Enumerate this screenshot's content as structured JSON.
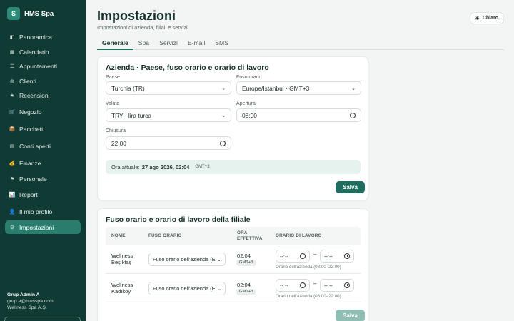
{
  "app": {
    "logo_letter": "S",
    "name": "HMS Spa"
  },
  "sidebar": {
    "items": [
      {
        "label": "Panoramica",
        "icon": "dashboard-icon",
        "glyph": "◧"
      },
      {
        "label": "Calendario",
        "icon": "calendar-icon",
        "glyph": "▦"
      },
      {
        "label": "Appuntamenti",
        "icon": "appointments-icon",
        "glyph": "☰"
      },
      {
        "label": "Clienti",
        "icon": "clients-icon",
        "glyph": "◍"
      },
      {
        "label": "Recensioni",
        "icon": "star-icon",
        "glyph": "★"
      },
      {
        "label": "Negozio",
        "icon": "cart-icon",
        "glyph": "🛒"
      },
      {
        "label": "Pacchetti",
        "icon": "package-icon",
        "glyph": "📦"
      },
      {
        "label": "Conti aperti",
        "icon": "bill-icon",
        "glyph": "▤"
      },
      {
        "label": "Finanze",
        "icon": "finance-icon",
        "glyph": "💰"
      },
      {
        "label": "Personale",
        "icon": "staff-icon",
        "glyph": "⚑"
      },
      {
        "label": "Report",
        "icon": "report-icon",
        "glyph": "📊"
      },
      {
        "label": "Il mio profilo",
        "icon": "profile-icon",
        "glyph": "👤"
      },
      {
        "label": "Impostazioni",
        "icon": "settings-icon",
        "glyph": "⚙"
      }
    ],
    "user": {
      "name": "Grup Admin A",
      "email": "grup.a@hmsspa.com",
      "company": "Wellness Spa A.Ş."
    }
  },
  "header": {
    "title": "Impostazioni",
    "subtitle": "Impostazioni di azienda, filiali e servizi",
    "theme_label": "Chiaro",
    "theme_glyph": "☀"
  },
  "tabs": [
    "Generale",
    "Spa",
    "Servizi",
    "E-mail",
    "SMS"
  ],
  "company_card": {
    "title": "Azienda · Paese, fuso orario e orario di lavoro",
    "country_label": "Paese",
    "country_value": "Turchia (TR)",
    "timezone_label": "Fuso orario",
    "timezone_value": "Europe/Istanbul · GMT+3",
    "currency_label": "Valuta",
    "currency_value": "TRY · lira turca",
    "opening_label": "Apertura",
    "opening_value": "08:00",
    "closing_label": "Chiusura",
    "closing_value": "22:00",
    "now_prefix": "Ora attuale:",
    "now_value": "27 ago 2026, 02:04",
    "now_tz": "GMT+3",
    "save_label": "Salva"
  },
  "branch_card": {
    "title": "Fuso orario e orario di lavoro della filiale",
    "headers": {
      "name": "NOME",
      "timezone": "FUSO ORARIO",
      "effective_1": "ORA",
      "effective_2": "EFFETTIVA",
      "hours": "ORARIO DI LAVORO"
    },
    "rows": [
      {
        "name_1": "Wellness",
        "name_2": "Beşiktaş",
        "timezone": "Fuso orario dell'azienda (E",
        "time": "02:04",
        "tz": "GMT+3",
        "from": "--:--",
        "to": "--:--",
        "note": "Orario dell'azienda (08:00–22:00)"
      },
      {
        "name_1": "Wellness",
        "name_2": "Kadıköy",
        "timezone": "Fuso orario dell'azienda (E",
        "time": "02:04",
        "tz": "GMT+3",
        "from": "--:--",
        "to": "--:--",
        "note": "Orario dell'azienda (08:00–22:00)"
      }
    ],
    "dash": "–",
    "save_label": "Salva"
  }
}
